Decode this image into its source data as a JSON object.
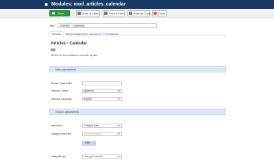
{
  "header": {
    "title": "Modules: mod_articles_calendar"
  },
  "toolbar": {
    "save_label": "Save",
    "save_close_label": "Save & Close",
    "save_new_label": "Save & New",
    "save_copy_label": "Save as Copy",
    "close_label": "Close"
  },
  "form": {
    "title_label": "Title *",
    "title_value": "Articles - Calendar"
  },
  "tabs": [
    "Module",
    "Menu Assignment",
    "Advanced",
    "Permissions"
  ],
  "module": {
    "title": "Articles - Calendar",
    "badge": "Site",
    "description": "Module for show articles in calendar by date"
  },
  "main_parameters": {
    "heading": "Main parameters",
    "suffix_label": "Module Class Suffix",
    "suffix_value": "",
    "theme_label": "Calendar Theme",
    "theme_value": "lightness",
    "language_label": "Calendar Language",
    "language_value": "English"
  },
  "search_parameters": {
    "heading": "Search parameters",
    "date_field_label": "Date Field",
    "date_field_value": "Creation date",
    "category_label": "Category restriction",
    "category_placeholder": "Select an option",
    "category_tag": "Cats",
    "listing_label": "Listing filter(s)",
    "listing_value": "Text good search"
  },
  "colors": {
    "header_bg": "#183a63",
    "save_green": "#2f9a3b",
    "section_bar": "#dbe8f6",
    "close_icon_red": "#d9534f"
  },
  "icons": [
    "cube-icon",
    "save-icon",
    "check-icon",
    "plus-icon",
    "copy-icon",
    "close-icon",
    "chevron-down-icon"
  ]
}
